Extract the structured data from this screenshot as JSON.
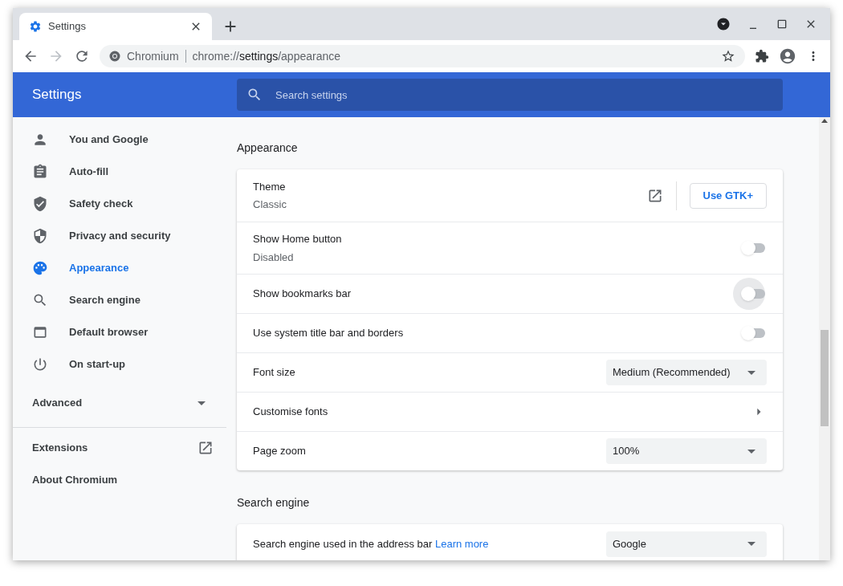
{
  "tab": {
    "title": "Settings",
    "selected": true
  },
  "toolbar": {
    "site_label": "Chromium",
    "url": {
      "scheme": "chrome://",
      "host": "settings",
      "path": "/appearance"
    }
  },
  "header": {
    "title": "Settings",
    "search": {
      "placeholder": "Search settings"
    }
  },
  "sidebar": {
    "items": [
      {
        "label": "You and Google",
        "selected": false
      },
      {
        "label": "Auto-fill",
        "selected": false
      },
      {
        "label": "Safety check",
        "selected": false
      },
      {
        "label": "Privacy and security",
        "selected": false
      },
      {
        "label": "Appearance",
        "selected": true
      },
      {
        "label": "Search engine",
        "selected": false
      },
      {
        "label": "Default browser",
        "selected": false
      },
      {
        "label": "On start-up",
        "selected": false
      }
    ],
    "advanced": {
      "label": "Advanced",
      "expanded": false
    },
    "extensions": "Extensions",
    "about": "About Chromium"
  },
  "sections": [
    {
      "title": "Appearance",
      "rows": [
        {
          "kind": "theme",
          "label": "Theme",
          "sublabel": "Classic",
          "button": "Use GTK+"
        },
        {
          "kind": "toggle",
          "label": "Show Home button",
          "sublabel": "Disabled",
          "on": false,
          "focused": false
        },
        {
          "kind": "toggle",
          "label": "Show bookmarks bar",
          "on": false,
          "focused": true
        },
        {
          "kind": "toggle",
          "label": "Use system title bar and borders",
          "on": false,
          "focused": false
        },
        {
          "kind": "select",
          "label": "Font size",
          "value": "Medium (Recommended)"
        },
        {
          "kind": "link",
          "label": "Customise fonts"
        },
        {
          "kind": "select",
          "label": "Page zoom",
          "value": "100%"
        }
      ]
    },
    {
      "title": "Search engine",
      "rows": [
        {
          "kind": "select",
          "label": "Search engine used in the address bar",
          "link": "Learn more",
          "value": "Google"
        }
      ]
    }
  ]
}
